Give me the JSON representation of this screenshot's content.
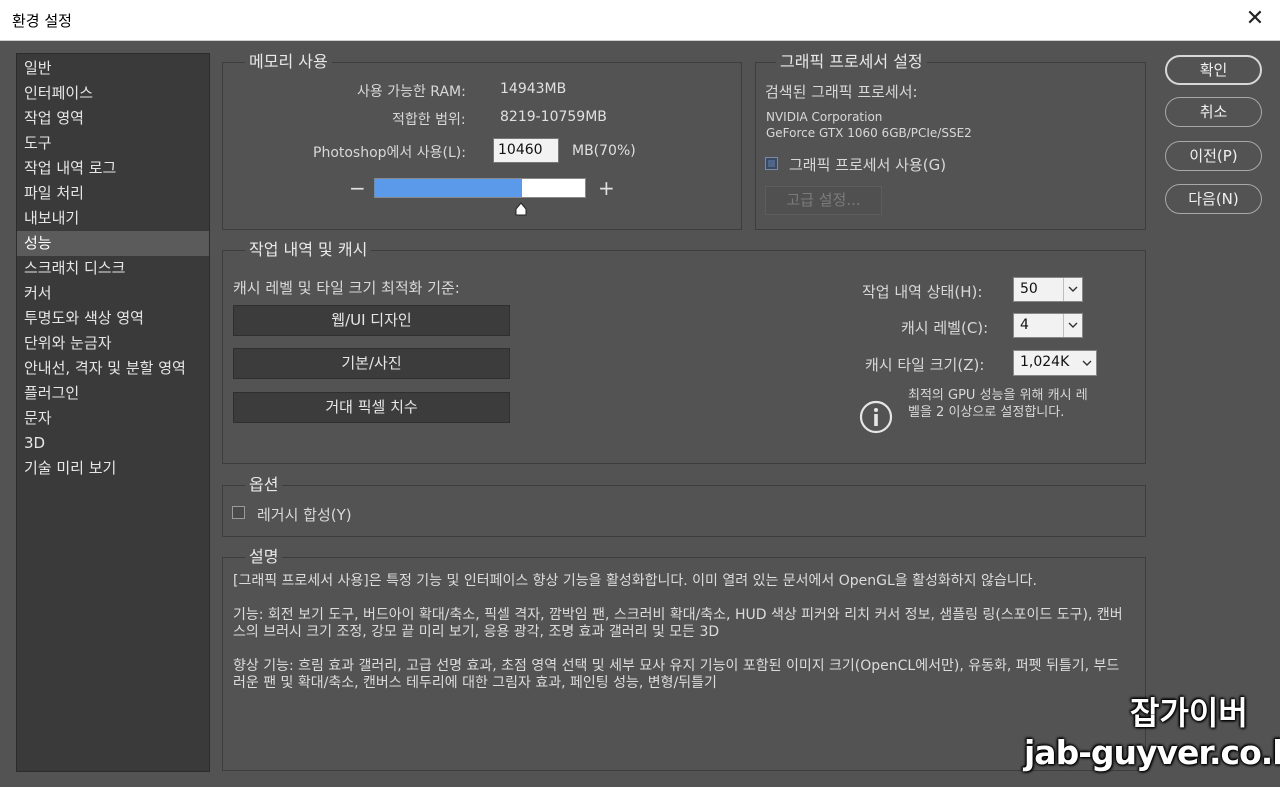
{
  "window": {
    "title": "환경 설정",
    "close_label": "✕"
  },
  "sidebar": {
    "items": [
      {
        "label": "일반"
      },
      {
        "label": "인터페이스"
      },
      {
        "label": "작업 영역"
      },
      {
        "label": "도구"
      },
      {
        "label": "작업 내역 로그"
      },
      {
        "label": "파일 처리"
      },
      {
        "label": "내보내기"
      },
      {
        "label": "성능",
        "active": true
      },
      {
        "label": "스크래치 디스크"
      },
      {
        "label": "커서"
      },
      {
        "label": "투명도와 색상 영역"
      },
      {
        "label": "단위와 눈금자"
      },
      {
        "label": "안내선, 격자 및 분할 영역"
      },
      {
        "label": "플러그인"
      },
      {
        "label": "문자"
      },
      {
        "label": "3D"
      },
      {
        "label": "기술 미리 보기"
      }
    ]
  },
  "memory": {
    "legend": "메모리 사용",
    "available_label": "사용 가능한 RAM:",
    "available_value": "14943MB",
    "range_label": "적합한 범위:",
    "range_value": "8219-10759MB",
    "usage_label": "Photoshop에서 사용(L):",
    "usage_value": "10460",
    "usage_unit": "MB(70%)",
    "slider_percent": 70,
    "minus": "−",
    "plus": "+"
  },
  "gpu": {
    "legend": "그래픽 프로세서 설정",
    "detected_label": "검색된 그래픽 프로세서:",
    "vendor": "NVIDIA Corporation",
    "model": "GeForce GTX 1060 6GB/PCIe/SSE2",
    "use_gpu_label": "그래픽 프로세서 사용(G)",
    "use_gpu_checked": true,
    "advanced_label": "고급 설정..."
  },
  "history_cache": {
    "legend": "작업 내역 및 캐시",
    "optimize_label": "캐시 레벨 및 타일 크기 최적화 기준:",
    "presets": [
      "웹/UI 디자인",
      "기본/사진",
      "거대 픽셀 치수"
    ],
    "history_states_label": "작업 내역 상태(H):",
    "history_states_value": "50",
    "cache_levels_label": "캐시 레벨(C):",
    "cache_levels_value": "4",
    "tile_size_label": "캐시 타일 크기(Z):",
    "tile_size_value": "1,024K",
    "info_line1": "최적의 GPU 성능을 위해 캐시 레",
    "info_line2": "벨을 2 이상으로 설정합니다."
  },
  "options": {
    "legend": "옵션",
    "legacy_label": "레거시 합성(Y)",
    "legacy_checked": false
  },
  "description": {
    "legend": "설명",
    "para1": "[그래픽 프로세서 사용]은 특정 기능 및 인터페이스 향상 기능을 활성화합니다. 이미 열려 있는 문서에서 OpenGL을 활성화하지 않습니다.",
    "para2": "기능: 회전 보기 도구, 버드아이 확대/축소, 픽셀 격자, 깜박임 팬, 스크러비 확대/축소, HUD 색상 피커와 리치 커서 정보, 샘플링 링(스포이드 도구), 캔버스의 브러시 크기 조정, 강모 끝 미리 보기, 응용 광각, 조명 효과 갤러리 및 모든 3D",
    "para3": "향상 기능: 흐림 효과 갤러리, 고급 선명 효과, 초점 영역 선택 및 세부 묘사 유지 기능이 포함된 이미지 크기(OpenCL에서만), 유동화, 퍼펫 뒤틀기, 부드러운 팬 및 확대/축소, 캔버스 테두리에 대한 그림자 효과, 페인팅 성능, 변형/뒤틀기"
  },
  "dialog_buttons": {
    "ok": "확인",
    "cancel": "취소",
    "prev": "이전(P)",
    "next": "다음(N)"
  },
  "watermark": {
    "line1": "잡가이버",
    "line2": "jab-guyver.co.kr"
  },
  "colors": {
    "slider_fill": "#5b99ea",
    "panel_bg": "#535353",
    "sidebar_bg": "#3a3a3a"
  }
}
